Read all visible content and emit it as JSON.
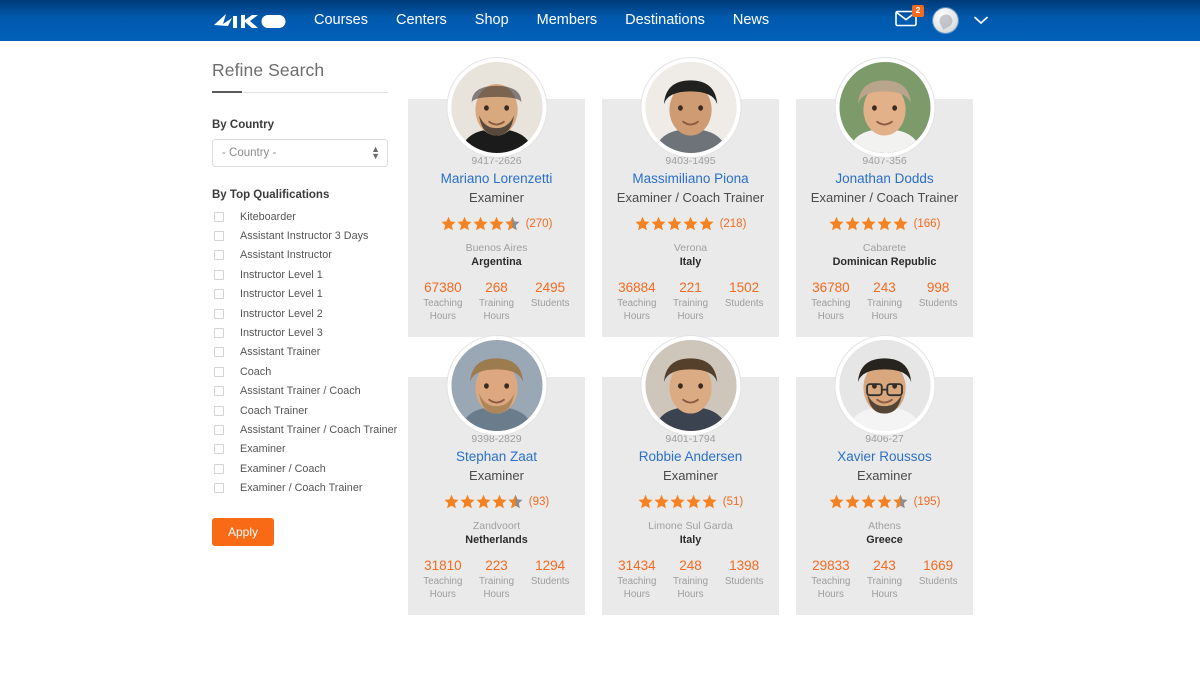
{
  "header": {
    "brand": "IKO",
    "nav": [
      {
        "label": "Courses"
      },
      {
        "label": "Centers"
      },
      {
        "label": "Shop"
      },
      {
        "label": "Members"
      },
      {
        "label": "Destinations"
      },
      {
        "label": "News"
      }
    ],
    "mail_badge": "2",
    "icons": {
      "mail": "mail-icon",
      "avatar": "user-avatar-icon",
      "chevron": "chevron-down-icon"
    }
  },
  "sidebar": {
    "title": "Refine Search",
    "country_label": "By Country",
    "country_selected": "- Country -",
    "country_options": [
      "- Country -"
    ],
    "qualifications_label": "By Top Qualifications",
    "qualifications": [
      "Kiteboarder",
      "Assistant Instructor 3 Days",
      "Assistant Instructor",
      "Instructor Level 1",
      "Instructor Level 1",
      "Instructor Level 2",
      "Instructor Level 3",
      "Assistant Trainer",
      "Coach",
      "Assistant Trainer / Coach",
      "Coach Trainer",
      "Assistant Trainer / Coach Trainer",
      "Examiner",
      "Examiner / Coach",
      "Examiner / Coach Trainer"
    ],
    "apply_label": "Apply"
  },
  "stat_labels": {
    "teaching": "Teaching Hours",
    "training": "Training Hours",
    "students": "Students"
  },
  "colors": {
    "header_blue": "#0159ad",
    "accent_orange": "#f36b21",
    "link_blue": "#2a6fc9",
    "card_bg": "#eaeaea",
    "star_filled": "#f58220",
    "star_empty": "#8c8c8c"
  },
  "members": [
    {
      "id": "9417-2626",
      "name": "Mariano Lorenzetti",
      "role": "Examiner",
      "stars": 4.5,
      "reviews": "(270)",
      "city": "Buenos Aires",
      "country": "Argentina",
      "teaching_hours": "67380",
      "training_hours": "268",
      "students": "2495",
      "photo": {
        "skin": "#d8a87f",
        "hair": "#2d2a28",
        "shirt": "#1b1b1b",
        "bg": "#e8e3db",
        "bald": true,
        "beard": true,
        "glasses": false
      }
    },
    {
      "id": "9403-1495",
      "name": "Massimiliano Piona",
      "role": "Examiner / Coach Trainer",
      "stars": 5,
      "reviews": "(218)",
      "city": "Verona",
      "country": "Italy",
      "teaching_hours": "36884",
      "training_hours": "221",
      "students": "1502",
      "photo": {
        "skin": "#cf9b72",
        "hair": "#20201f",
        "shirt": "#6e737a",
        "bg": "#efece7",
        "bald": false,
        "beard": false,
        "glasses": false
      }
    },
    {
      "id": "9407-356",
      "name": "Jonathan Dodds",
      "role": "Examiner / Coach Trainer",
      "stars": 5,
      "reviews": "(166)",
      "city": "Cabarete",
      "country": "Dominican Republic",
      "teaching_hours": "36780",
      "training_hours": "243",
      "students": "998",
      "photo": {
        "skin": "#e2b089",
        "hair": "#b9a48c",
        "shirt": "#f2f2f0",
        "bg": "#7d9a6b",
        "bald": false,
        "beard": false,
        "glasses": false
      }
    },
    {
      "id": "9398-2829",
      "name": "Stephan Zaat",
      "role": "Examiner",
      "stars": 4.5,
      "reviews": "(93)",
      "city": "Zandvoort",
      "country": "Netherlands",
      "teaching_hours": "31810",
      "training_hours": "223",
      "students": "1294",
      "photo": {
        "skin": "#dda780",
        "hair": "#9c7b4e",
        "shirt": "#6b7c8c",
        "bg": "#9aa7b4",
        "bald": false,
        "beard": true,
        "glasses": false
      }
    },
    {
      "id": "9401-1794",
      "name": "Robbie Andersen",
      "role": "Examiner",
      "stars": 5,
      "reviews": "(51)",
      "city": "Limone Sul Garda",
      "country": "Italy",
      "teaching_hours": "31434",
      "training_hours": "248",
      "students": "1398",
      "photo": {
        "skin": "#dbab84",
        "hair": "#55402c",
        "shirt": "#3c4350",
        "bg": "#cfc6bb",
        "bald": false,
        "beard": false,
        "glasses": false
      }
    },
    {
      "id": "9406-27",
      "name": "Xavier Roussos",
      "role": "Examiner",
      "stars": 4.5,
      "reviews": "(195)",
      "city": "Athens",
      "country": "Greece",
      "teaching_hours": "29833",
      "training_hours": "243",
      "students": "1669",
      "photo": {
        "skin": "#d9a77e",
        "hair": "#27241f",
        "shirt": "#f4f4f4",
        "bg": "#e6e6e6",
        "bald": false,
        "beard": true,
        "glasses": true
      }
    }
  ]
}
